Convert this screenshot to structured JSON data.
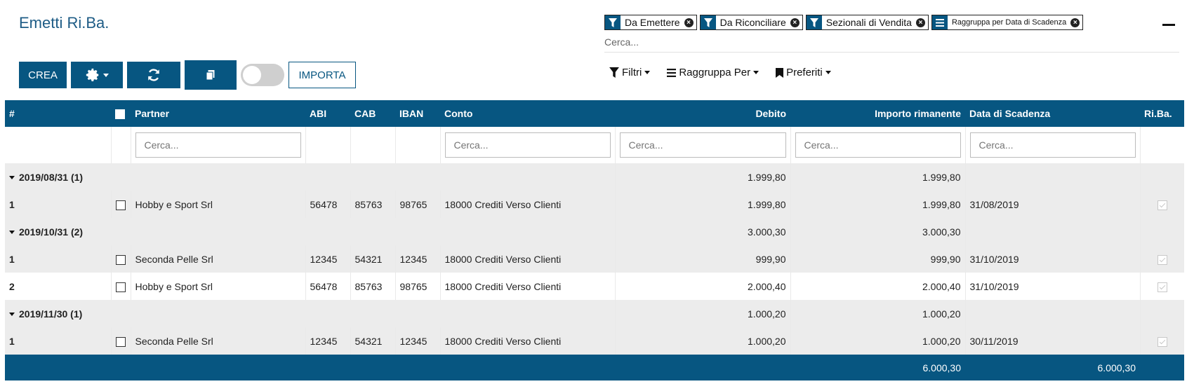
{
  "title": "Emetti Ri.Ba.",
  "buttons": {
    "crea": "CREA",
    "importa": "IMPORTA"
  },
  "icons": {
    "gear": "gear-icon",
    "refresh": "refresh-icon",
    "copy": "copy-icon",
    "filter": "filter-icon",
    "group": "list-icon"
  },
  "facets": [
    {
      "label": "Da Emettere",
      "type": "filter"
    },
    {
      "label": "Da Riconciliare",
      "type": "filter"
    },
    {
      "label": "Sezionali di Vendita",
      "type": "filter"
    },
    {
      "label": "Raggruppa per Data di Scadenza",
      "type": "group"
    }
  ],
  "search": {
    "placeholder": "Cerca..."
  },
  "menus": {
    "filtri": "Filtri",
    "raggruppa": "Raggruppa Per",
    "preferiti": "Preferiti"
  },
  "columns": {
    "num": "#",
    "partner": "Partner",
    "abi": "ABI",
    "cab": "CAB",
    "iban": "IBAN",
    "conto": "Conto",
    "debito": "Debito",
    "importo": "Importo rimanente",
    "scadenza": "Data di Scadenza",
    "riba": "Ri.Ba."
  },
  "filter_placeholder": "Cerca...",
  "groups": [
    {
      "label": "2019/08/31 (1)",
      "debito": "1.999,80",
      "importo": "1.999,80",
      "rows": [
        {
          "num": "1",
          "partner": "Hobby e Sport Srl",
          "abi": "56478",
          "cab": "85763",
          "iban": "98765",
          "conto": "18000 Crediti Verso Clienti",
          "debito": "1.999,80",
          "importo": "1.999,80",
          "scadenza": "31/08/2019"
        }
      ]
    },
    {
      "label": "2019/10/31 (2)",
      "debito": "3.000,30",
      "importo": "3.000,30",
      "rows": [
        {
          "num": "1",
          "partner": "Seconda Pelle Srl",
          "abi": "12345",
          "cab": "54321",
          "iban": "12345",
          "conto": "18000 Crediti Verso Clienti",
          "debito": "999,90",
          "importo": "999,90",
          "scadenza": "31/10/2019"
        },
        {
          "num": "2",
          "partner": "Hobby e Sport Srl",
          "abi": "56478",
          "cab": "85763",
          "iban": "98765",
          "conto": "18000 Crediti Verso Clienti",
          "debito": "2.000,40",
          "importo": "2.000,40",
          "scadenza": "31/10/2019"
        }
      ]
    },
    {
      "label": "2019/11/30 (1)",
      "debito": "1.000,20",
      "importo": "1.000,20",
      "rows": [
        {
          "num": "1",
          "partner": "Seconda Pelle Srl",
          "abi": "12345",
          "cab": "54321",
          "iban": "12345",
          "conto": "18000 Crediti Verso Clienti",
          "debito": "1.000,20",
          "importo": "1.000,20",
          "scadenza": "30/11/2019"
        }
      ]
    }
  ],
  "totals": {
    "debito": "6.000,30",
    "importo": "6.000,30"
  },
  "colors": {
    "primary": "#075681",
    "title": "#1e5c86",
    "group_bg": "#ececec"
  }
}
